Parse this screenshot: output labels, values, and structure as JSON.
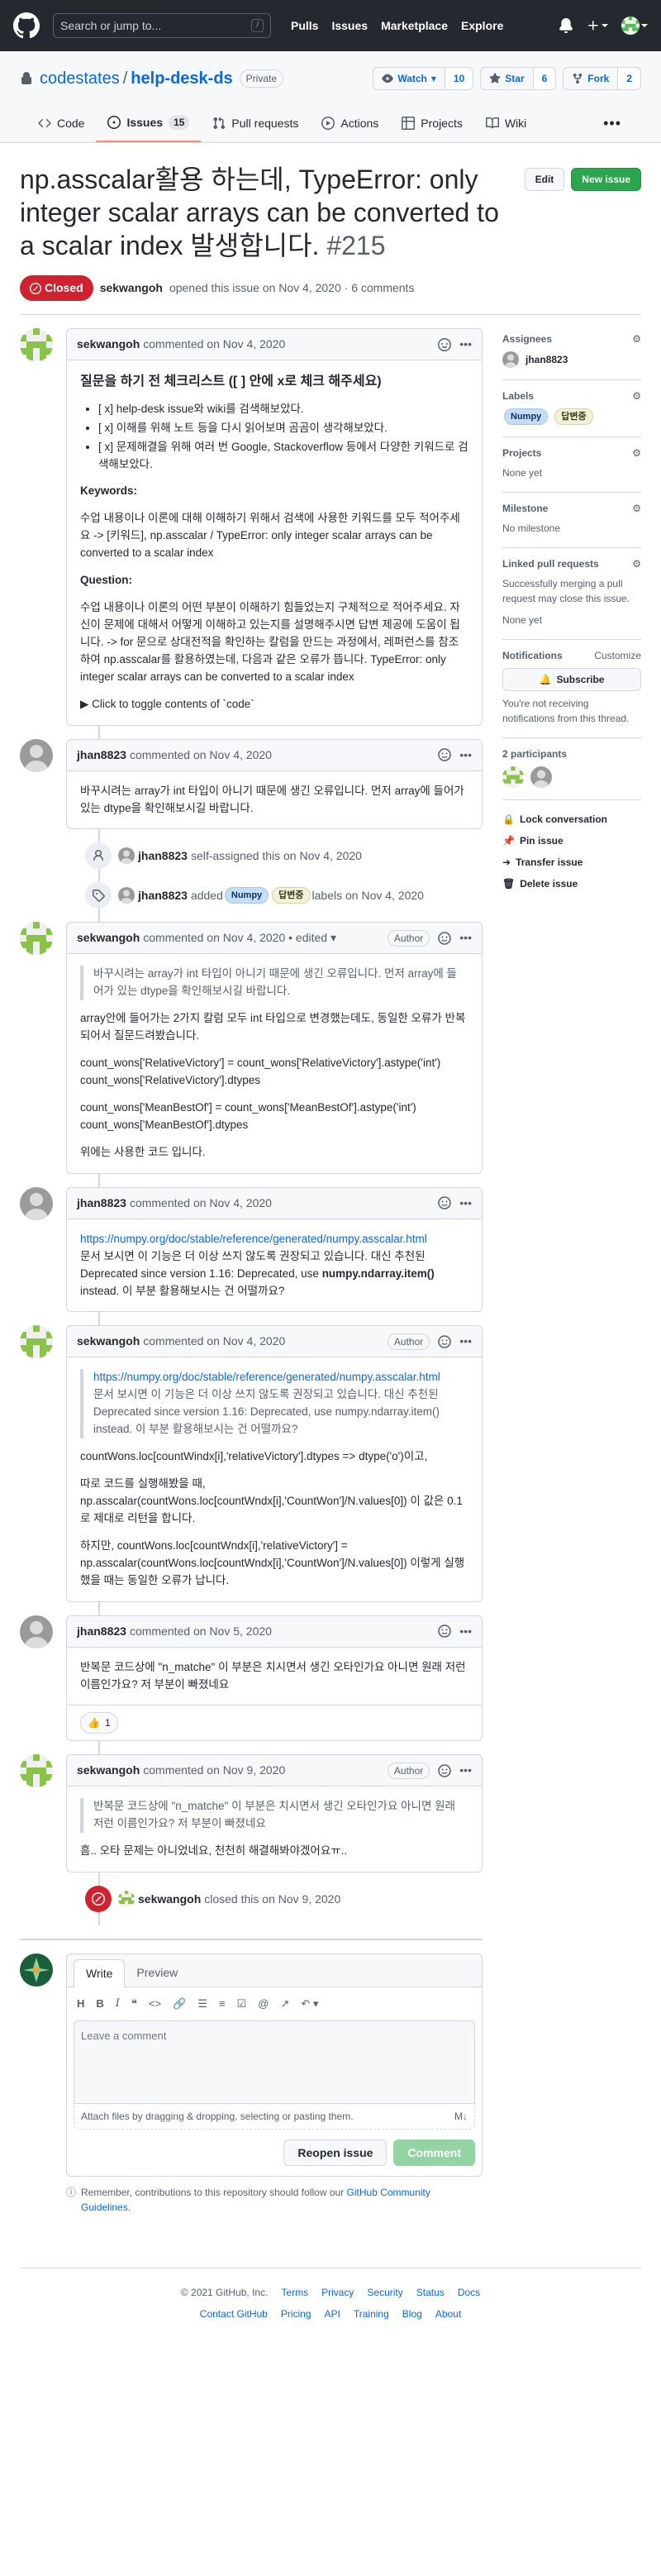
{
  "header": {
    "search_placeholder": "Search or jump to...",
    "slash": "/",
    "nav": [
      "Pulls",
      "Issues",
      "Marketplace",
      "Explore"
    ]
  },
  "repo": {
    "owner": "codestates",
    "name": "help-desk-ds",
    "visibility": "Private",
    "watch_label": "Watch",
    "watch_count": "10",
    "star_label": "Star",
    "star_count": "6",
    "fork_label": "Fork",
    "fork_count": "2",
    "tabs": {
      "code": "Code",
      "issues": "Issues",
      "issues_count": "15",
      "pulls": "Pull requests",
      "actions": "Actions",
      "projects": "Projects",
      "wiki": "Wiki"
    }
  },
  "issue": {
    "title": "np.asscalar활용 하는데, TypeError: only integer scalar arrays can be converted to a scalar index 발생합니다.",
    "number": "#215",
    "edit_label": "Edit",
    "new_issue_label": "New issue",
    "state": "Closed",
    "author": "sekwangoh",
    "opened_text": "opened this issue on Nov 4, 2020 · 6 comments"
  },
  "comments": {
    "c1": {
      "author": "sekwangoh",
      "date": "commented on Nov 4, 2020",
      "heading": "질문을 하기 전 체크리스트 ([ ] 안에 x로 체크 해주세요)",
      "checklist": [
        "[ x] help-desk issue와 wiki를 검색해보았다.",
        "[ x] 이해를 위해 노트 등을 다시 읽어보며 곰곰이 생각해보았다.",
        "[ x] 문제해결을 위해 여러 번 Google, Stackoverflow 등에서 다양한 키워드로 검색해보았다."
      ],
      "keywords_label": "Keywords:",
      "keywords_text": "수업 내용이나 이론에 대해 이해하기 위해서 검색에 사용한 키워드를 모두 적어주세요 -> [키워드], np.asscalar / TypeError: only integer scalar arrays can be converted to a scalar index",
      "question_label": "Question:",
      "question_text": "수업 내용이나 이론의 어떤 부분이 이해하기 힘들었는지 구체적으로 적어주세요. 자신이 문제에 대해서 어떻게 이해하고 있는지를 설명해주시면 답변 제공에 도움이 됩니다. -> for 문으로 상대전적을 확인하는 칼럼을 만드는 과정에서, 레퍼런스를 참조하여 np.asscalar를 활용하였는데, 다음과 같은 오류가 뜹니다. TypeError: only integer scalar arrays can be converted to a scalar index",
      "toggle": "Click to toggle contents of `code`"
    },
    "c2": {
      "author": "jhan8823",
      "date": "commented on Nov 4, 2020",
      "body": "바꾸시려는 array가 int 타입이 아니기 때문에 생긴 오류입니다. 먼저 array에 들어가 있는 dtype을 확인해보시길 바랍니다."
    },
    "ev_assign": {
      "author": "jhan8823",
      "text": "self-assigned this on Nov 4, 2020"
    },
    "ev_label": {
      "author": "jhan8823",
      "added": "added",
      "text": "labels on Nov 4, 2020"
    },
    "c3": {
      "author": "sekwangoh",
      "date": "commented on Nov 4, 2020",
      "edited": "• edited",
      "badge": "Author",
      "quote": "바꾸시려는 array가 int 타입이 아니기 때문에 생긴 오류입니다. 먼저 array에 들어가 있는 dtype을 확인해보시길 바랍니다.",
      "p1": "array안에 들어가는 2가지 칼럼 모두 int 타입으로 변경했는데도, 동일한 오류가 반복되어서 질문드려봤습니다.",
      "code1a": "count_wons['RelativeVictory'] = count_wons['RelativeVictory'].astype('int')",
      "code1b": "count_wons['RelativeVictory'].dtypes",
      "code2a": "count_wons['MeanBestOf'] = count_wons['MeanBestOf'].astype('int')",
      "code2b": "count_wons['MeanBestOf'].dtypes",
      "p2": "위에는 사용한 코드 입니다."
    },
    "c4": {
      "author": "jhan8823",
      "date": "commented on Nov 4, 2020",
      "link": "https://numpy.org/doc/stable/reference/generated/numpy.asscalar.html",
      "line1": "문서 보시면 이 기능은 더 이상 쓰지 않도록 권장되고 있습니다. 대신 추천된 Deprecated since version 1.16: Deprecated, use",
      "bold": "numpy.ndarray.item()",
      "line2": "instead. 이 부분 활용해보시는 건 어떨까요?"
    },
    "c5": {
      "author": "sekwangoh",
      "date": "commented on Nov 4, 2020",
      "badge": "Author",
      "quote_link": "https://numpy.org/doc/stable/reference/generated/numpy.asscalar.html",
      "quote": "문서 보시면 이 기능은 더 이상 쓰지 않도록 권장되고 있습니다. 대신 추천된 Deprecated since version 1.16: Deprecated, use numpy.ndarray.item() instead. 이 부분 활용해보시는 건 어떨까요?",
      "p1": "countWons.loc[countWindx[i],'relativeVictory'].dtypes => dtype('o')이고,",
      "p2": "따로 코드를 실행해봤을 때, np.asscalar(countWons.loc[countWndx[i],'CountWon']/N.values[0]) 이 값은 0.1로 제대로 리턴을 합니다.",
      "p3": "하지만, countWons.loc[countWndx[i],'relativeVictory'] = np.asscalar(countWons.loc[countWndx[i],'CountWon']/N.values[0]) 이렇게 실행했을 때는 동일한 오류가 납니다."
    },
    "c6": {
      "author": "jhan8823",
      "date": "commented on Nov 5, 2020",
      "body": "반복문 코드상에 \"n_matche\" 이 부분은 치시면서 생긴 오타인가요 아니면 원래 저런 이름인가요? 저 부분이 빠졌네요",
      "reaction_icon": "thumbs-up",
      "reaction_count": "1"
    },
    "c7": {
      "author": "sekwangoh",
      "date": "commented on Nov 9, 2020",
      "badge": "Author",
      "quote": "반복문 코드상에 \"n_matche\" 이 부분은 치시면서 생긴 오타인가요 아니면 원래 저런 이름인가요? 저 부분이 빠졌네요",
      "body": "흠.. 오타 문제는 아니었네요, 천천히 해결해봐야겠어요ㅠ.."
    },
    "ev_closed": {
      "author": "sekwangoh",
      "text": "closed this on Nov 9, 2020"
    }
  },
  "labels": {
    "numpy": "Numpy",
    "answered": "답변중"
  },
  "new_comment": {
    "write_tab": "Write",
    "preview_tab": "Preview",
    "placeholder": "Leave a comment",
    "attach": "Attach files by dragging & dropping, selecting or pasting them.",
    "reopen": "Reopen issue",
    "comment": "Comment",
    "remember_pre": "Remember, contributions to this repository should follow our",
    "remember_link": "GitHub Community Guidelines",
    "remember_post": "."
  },
  "sidebar": {
    "assignees_label": "Assignees",
    "assignee": "jhan8823",
    "labels_label": "Labels",
    "projects_label": "Projects",
    "projects_value": "None yet",
    "milestone_label": "Milestone",
    "milestone_value": "No milestone",
    "linked_label": "Linked pull requests",
    "linked_text": "Successfully merging a pull request may close this issue.",
    "linked_value": "None yet",
    "notifications_label": "Notifications",
    "customize": "Customize",
    "subscribe": "Subscribe",
    "notif_text": "You're not receiving notifications from this thread.",
    "participants_label": "2 participants",
    "lock": "Lock conversation",
    "pin": "Pin issue",
    "transfer": "Transfer issue",
    "delete": "Delete issue"
  },
  "footer": {
    "copyright": "© 2021 GitHub, Inc.",
    "row1": [
      "Terms",
      "Privacy",
      "Security",
      "Status",
      "Docs"
    ],
    "row2": [
      "Contact GitHub",
      "Pricing",
      "API",
      "Training",
      "Blog",
      "About"
    ]
  },
  "colors": {
    "header_bg": "#24292f",
    "closed_red": "#cf222e",
    "green": "#2da44e",
    "link": "#0969da"
  }
}
